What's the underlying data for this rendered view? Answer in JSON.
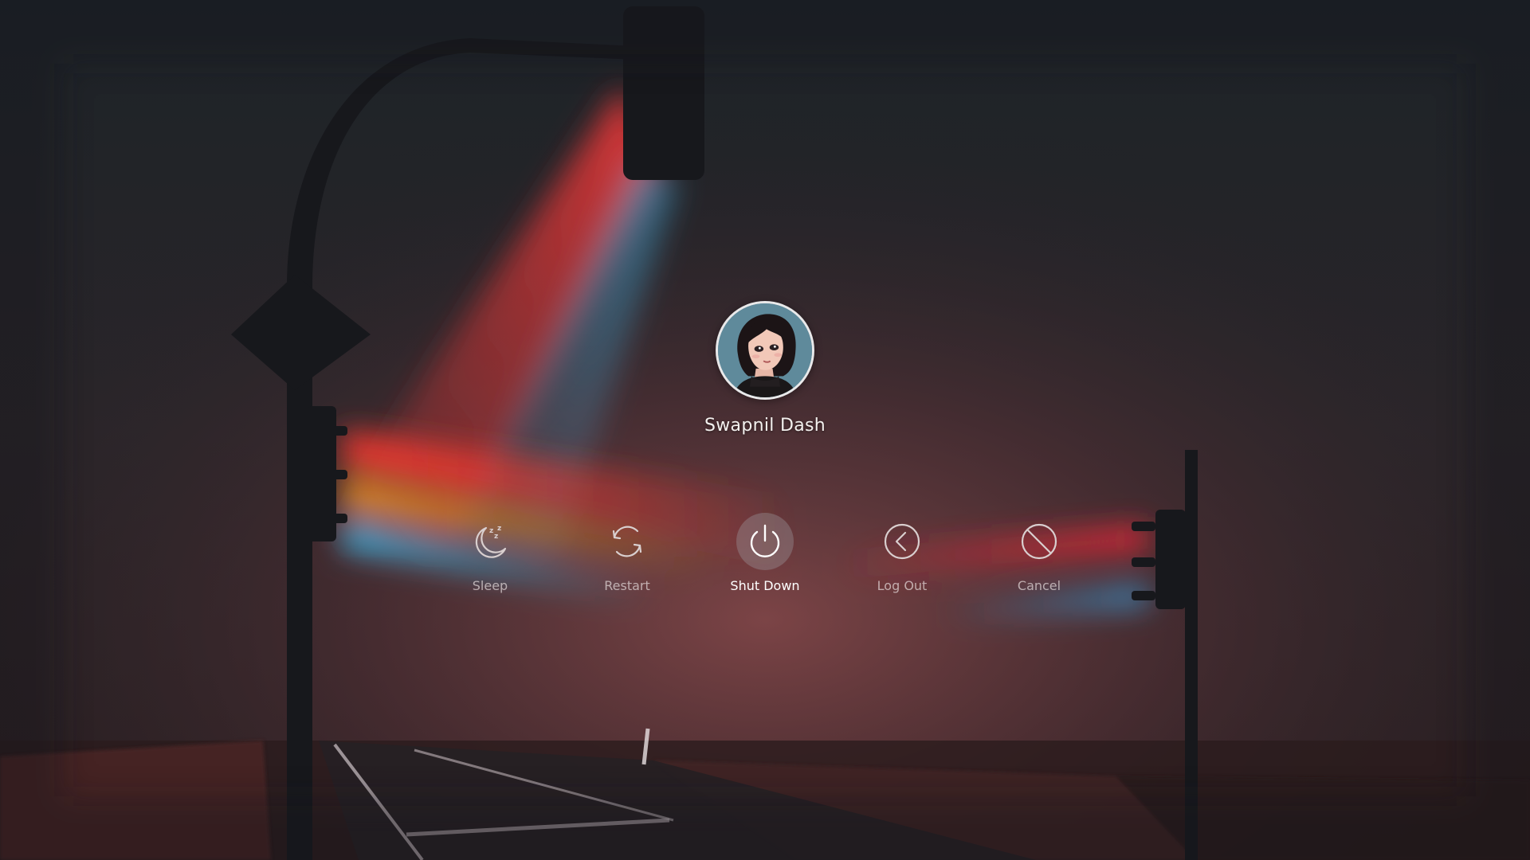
{
  "user": {
    "name": "Swapnil Dash"
  },
  "actions": [
    {
      "id": "sleep",
      "label": "Sleep",
      "icon": "sleep-moon-icon",
      "active": false
    },
    {
      "id": "restart",
      "label": "Restart",
      "icon": "restart-arrows-icon",
      "active": false
    },
    {
      "id": "shutdown",
      "label": "Shut Down",
      "icon": "power-icon",
      "active": true
    },
    {
      "id": "logout",
      "label": "Log Out",
      "icon": "chevron-left-circle-icon",
      "active": false
    },
    {
      "id": "cancel",
      "label": "Cancel",
      "icon": "cancel-circle-icon",
      "active": false
    }
  ],
  "colors": {
    "icon_stroke": "#d9cfcf",
    "active_stroke": "#ffffff",
    "highlight_bg": "#8f8f95"
  }
}
